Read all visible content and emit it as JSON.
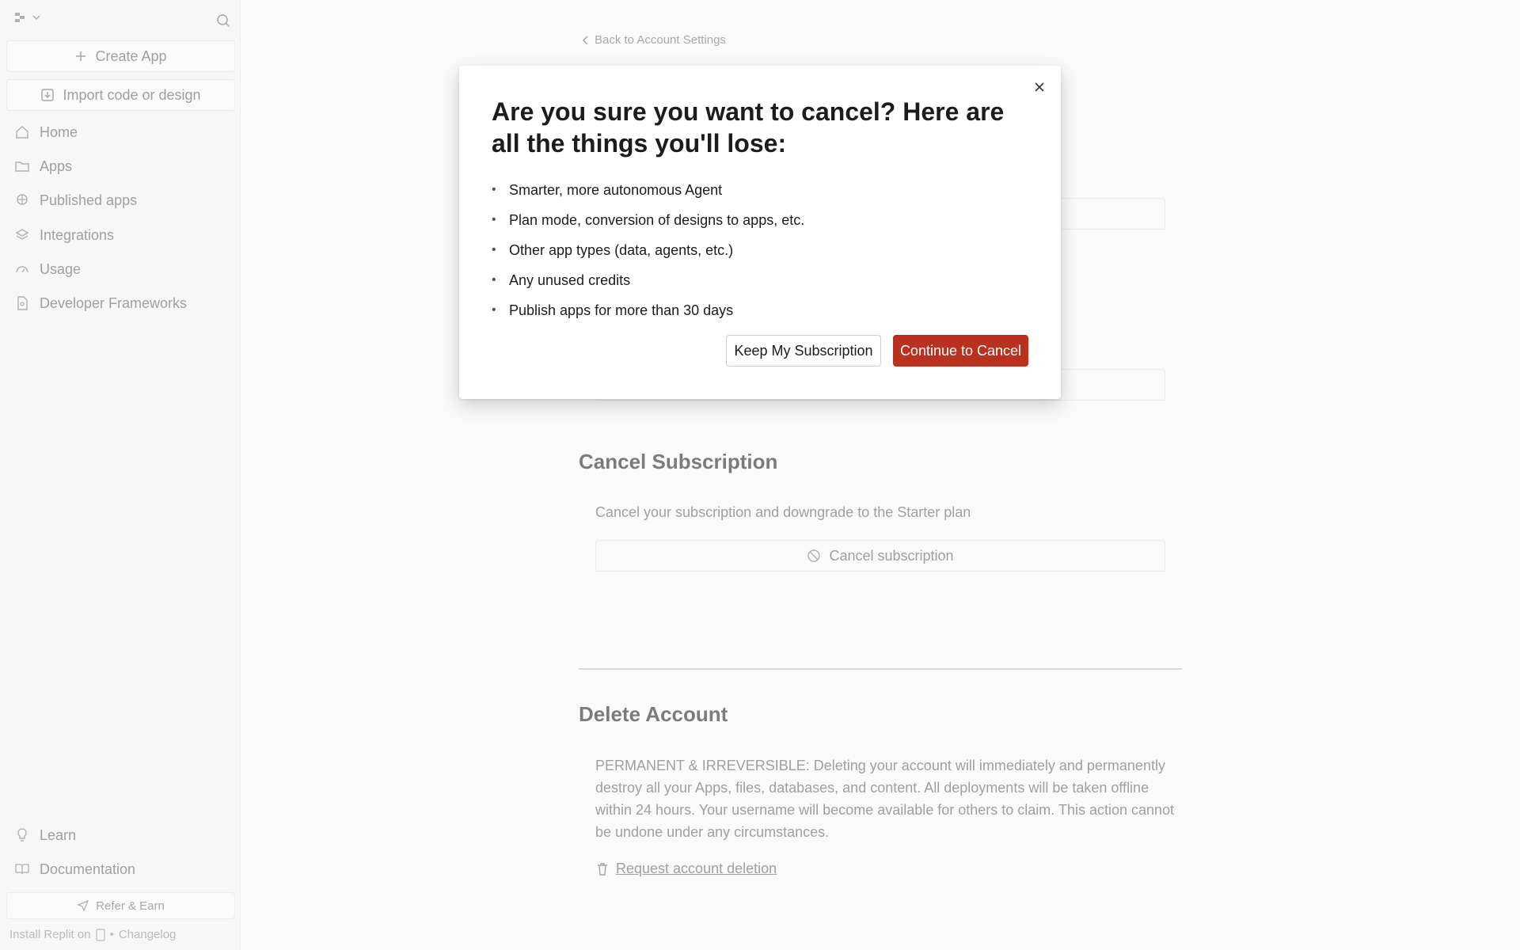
{
  "sidebar": {
    "create_app": "Create App",
    "import": "Import code or design",
    "nav": [
      {
        "label": "Home"
      },
      {
        "label": "Apps"
      },
      {
        "label": "Published apps"
      },
      {
        "label": "Integrations"
      },
      {
        "label": "Usage"
      },
      {
        "label": "Developer Frameworks"
      }
    ],
    "bottom_nav": [
      {
        "label": "Learn"
      },
      {
        "label": "Documentation"
      }
    ],
    "refer": "Refer & Earn",
    "install": "Install Replit on",
    "separator": "•",
    "changelog": "Changelog"
  },
  "main": {
    "back_link": "Back to Account Settings",
    "cancel_section": {
      "title": "Cancel Subscription",
      "description": "Cancel your subscription and downgrade to the Starter plan",
      "button": "Cancel subscription"
    },
    "delete_section": {
      "title": "Delete Account",
      "description": "PERMANENT & IRREVERSIBLE: Deleting your account will immediately and permanently destroy all your Apps, files, databases, and content. All deployments will be taken offline within 24 hours. Your username will become available for others to claim. This action cannot be undone under any circumstances.",
      "link": "Request account deletion"
    }
  },
  "modal": {
    "title": "Are you sure you want to cancel? Here are all the things you'll lose:",
    "items": [
      "Smarter, more autonomous Agent",
      "Plan mode, conversion of designs to apps, etc.",
      "Other app types (data, agents, etc.)",
      "Any unused credits",
      "Publish apps for more than 30 days"
    ],
    "keep_label": "Keep My Subscription",
    "continue_label": "Continue to Cancel"
  },
  "colors": {
    "danger": "#b8321f",
    "sidebar_bg": "#f2f2f2"
  }
}
